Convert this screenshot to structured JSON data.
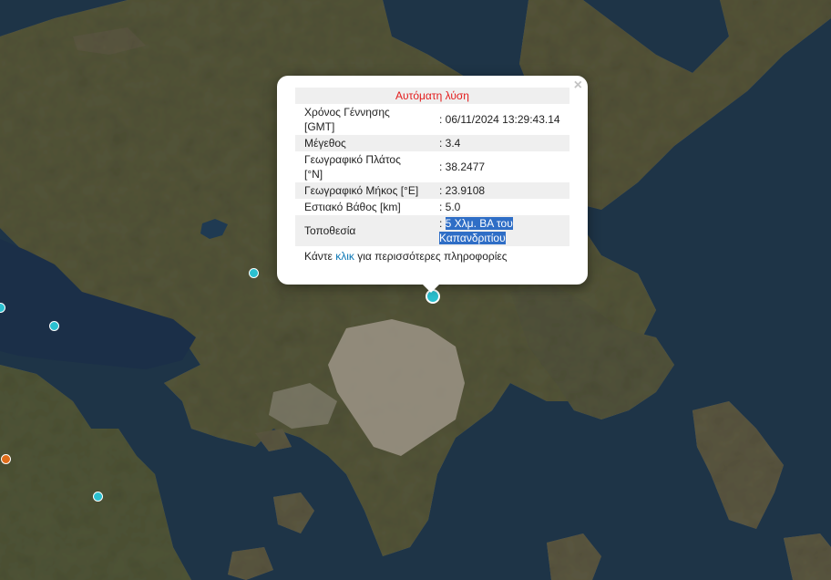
{
  "popup": {
    "title": "Αυτόματη λύση",
    "close": "×",
    "rows": [
      {
        "key": "Χρόνος Γέννησης [GMT]",
        "value": ": 06/11/2024 13:29:43.14"
      },
      {
        "key": "Μέγεθος",
        "value": ": 3.4"
      },
      {
        "key": "Γεωγραφικό Πλάτος [°N]",
        "value": ": 38.2477"
      },
      {
        "key": "Γεωγραφικό Μήκος [°E]",
        "value": ": 23.9108"
      },
      {
        "key": "Εστιακό Βάθος [km]",
        "value": ": 5.0"
      }
    ],
    "location": {
      "key": "Τοποθεσία",
      "prefix": ": ",
      "value": "5 Χλμ. ΒΑ του Καπανδριτίου"
    },
    "more": {
      "before": "Κάντε ",
      "link": "κλικ",
      "after": " για περισσότερες πληροφορίες"
    }
  },
  "colors": {
    "sea": "#1e3447",
    "land": "#4e5136",
    "city": "#9c9486",
    "marker_cyan": "#2bc0d0",
    "marker_orange": "#e06c1a",
    "title_red": "#e31b1b",
    "link": "#0c77b5"
  }
}
